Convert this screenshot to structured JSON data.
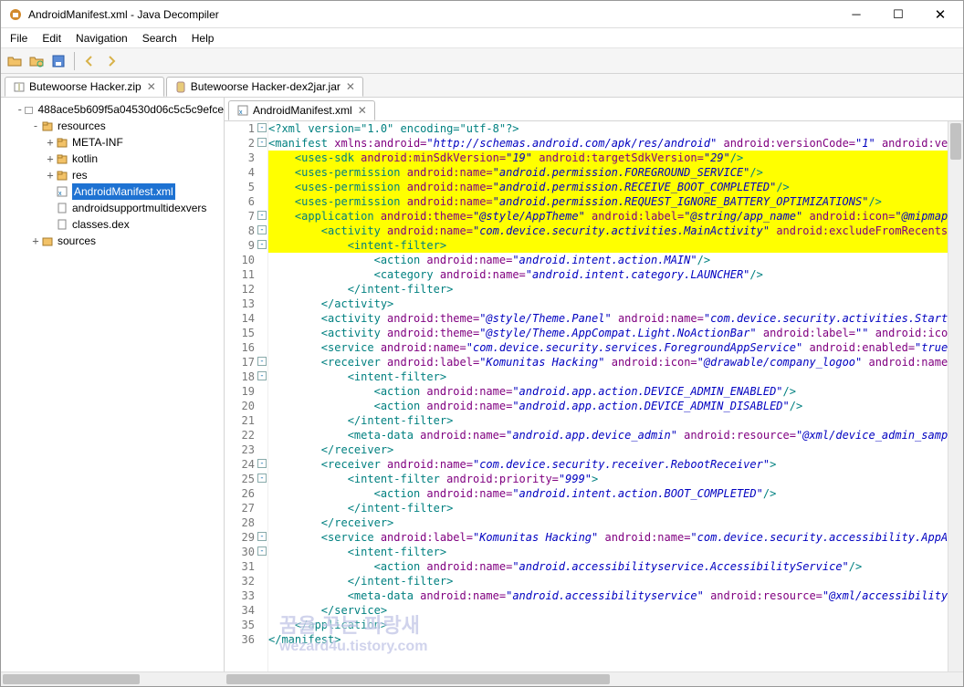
{
  "window": {
    "title": "AndroidManifest.xml - Java Decompiler"
  },
  "menu": [
    "File",
    "Edit",
    "Navigation",
    "Search",
    "Help"
  ],
  "topTabs": [
    {
      "label": "Butewoorse Hacker.zip",
      "closable": true,
      "ico": "archive"
    },
    {
      "label": "Butewoorse Hacker-dex2jar.jar",
      "closable": true,
      "ico": "jar"
    }
  ],
  "tree": {
    "root": "488ace5b609f5a04530d06c5c5c9efce",
    "nodes": [
      {
        "d": 1,
        "label": "resources",
        "ico": "pkg",
        "tw": "-"
      },
      {
        "d": 2,
        "label": "META-INF",
        "ico": "pkg",
        "tw": "+"
      },
      {
        "d": 2,
        "label": "kotlin",
        "ico": "pkg",
        "tw": "+"
      },
      {
        "d": 2,
        "label": "res",
        "ico": "pkg",
        "tw": "+"
      },
      {
        "d": 2,
        "label": "AndroidManifest.xml",
        "ico": "xml",
        "sel": true
      },
      {
        "d": 2,
        "label": "androidsupportmultidexvers",
        "ico": "file"
      },
      {
        "d": 2,
        "label": "classes.dex",
        "ico": "file"
      },
      {
        "d": 1,
        "label": "sources",
        "ico": "folder",
        "tw": "+"
      }
    ]
  },
  "editorTab": {
    "label": "AndroidManifest.xml",
    "closable": true,
    "ico": "xml"
  },
  "code": [
    {
      "n": 1,
      "fold": "-",
      "seg": [
        [
          "pi",
          "<?xml version=\"1.0\" encoding=\"utf-8\"?>"
        ]
      ]
    },
    {
      "n": 2,
      "fold": "-",
      "seg": [
        [
          "tag",
          "<manifest "
        ],
        [
          "attr",
          "xmlns:android="
        ],
        [
          "str",
          "\"http://schemas.android.com/apk/res/android\""
        ],
        [
          "tag",
          " "
        ],
        [
          "attr",
          "android:versionCode="
        ],
        [
          "str",
          "\"1\""
        ],
        [
          "tag",
          " "
        ],
        [
          "attr",
          "android:versio"
        ]
      ]
    },
    {
      "n": 3,
      "hl": true,
      "seg": [
        [
          "tag",
          "    <uses-sdk "
        ],
        [
          "attr",
          "android:minSdkVersion="
        ],
        [
          "str",
          "\"19\""
        ],
        [
          "tag",
          " "
        ],
        [
          "attr",
          "android:targetSdkVersion="
        ],
        [
          "str",
          "\"29\""
        ],
        [
          "tag",
          "/>"
        ]
      ]
    },
    {
      "n": 4,
      "hl": true,
      "seg": [
        [
          "tag",
          "    <uses-permission "
        ],
        [
          "attr",
          "android:name="
        ],
        [
          "str",
          "\"android.permission.FOREGROUND_SERVICE\""
        ],
        [
          "tag",
          "/>"
        ]
      ]
    },
    {
      "n": 5,
      "hl": true,
      "seg": [
        [
          "tag",
          "    <uses-permission "
        ],
        [
          "attr",
          "android:name="
        ],
        [
          "str",
          "\"android.permission.RECEIVE_BOOT_COMPLETED\""
        ],
        [
          "tag",
          "/>"
        ]
      ]
    },
    {
      "n": 6,
      "hl": true,
      "seg": [
        [
          "tag",
          "    <uses-permission "
        ],
        [
          "attr",
          "android:name="
        ],
        [
          "str",
          "\"android.permission.REQUEST_IGNORE_BATTERY_OPTIMIZATIONS\""
        ],
        [
          "tag",
          "/>"
        ]
      ]
    },
    {
      "n": 7,
      "fold": "-",
      "hl": true,
      "seg": [
        [
          "tag",
          "    <application "
        ],
        [
          "attr",
          "android:theme="
        ],
        [
          "str",
          "\"@style/AppTheme\""
        ],
        [
          "tag",
          " "
        ],
        [
          "attr",
          "android:label="
        ],
        [
          "str",
          "\"@string/app_name\""
        ],
        [
          "tag",
          " "
        ],
        [
          "attr",
          "android:icon="
        ],
        [
          "str",
          "\"@mipmap/ic_"
        ]
      ]
    },
    {
      "n": 8,
      "fold": "-",
      "hl": true,
      "seg": [
        [
          "tag",
          "        <activity "
        ],
        [
          "attr",
          "android:name="
        ],
        [
          "str",
          "\"com.device.security.activities.MainActivity\""
        ],
        [
          "tag",
          " "
        ],
        [
          "attr",
          "android:excludeFromRecents="
        ],
        [
          "str",
          "\"tr"
        ]
      ]
    },
    {
      "n": 9,
      "fold": "-",
      "hl": true,
      "seg": [
        [
          "tag",
          "            <intent-filter>"
        ]
      ]
    },
    {
      "n": 10,
      "seg": [
        [
          "tag",
          "                <action "
        ],
        [
          "attr",
          "android:name="
        ],
        [
          "str",
          "\"android.intent.action.MAIN\""
        ],
        [
          "tag",
          "/>"
        ]
      ]
    },
    {
      "n": 11,
      "seg": [
        [
          "tag",
          "                <category "
        ],
        [
          "attr",
          "android:name="
        ],
        [
          "str",
          "\"android.intent.category.LAUNCHER\""
        ],
        [
          "tag",
          "/>"
        ]
      ]
    },
    {
      "n": 12,
      "seg": [
        [
          "tag",
          "            </intent-filter>"
        ]
      ]
    },
    {
      "n": 13,
      "seg": [
        [
          "tag",
          "        </activity>"
        ]
      ]
    },
    {
      "n": 14,
      "seg": [
        [
          "tag",
          "        <activity "
        ],
        [
          "attr",
          "android:theme="
        ],
        [
          "str",
          "\"@style/Theme.Panel\""
        ],
        [
          "tag",
          " "
        ],
        [
          "attr",
          "android:name="
        ],
        [
          "str",
          "\"com.device.security.activities.StartServ"
        ]
      ]
    },
    {
      "n": 15,
      "seg": [
        [
          "tag",
          "        <activity "
        ],
        [
          "attr",
          "android:theme="
        ],
        [
          "str",
          "\"@style/Theme.AppCompat.Light.NoActionBar\""
        ],
        [
          "tag",
          " "
        ],
        [
          "attr",
          "android:label="
        ],
        [
          "str",
          "\"\""
        ],
        [
          "tag",
          " "
        ],
        [
          "attr",
          "android:icon="
        ],
        [
          "str",
          "\"@"
        ]
      ]
    },
    {
      "n": 16,
      "seg": [
        [
          "tag",
          "        <service "
        ],
        [
          "attr",
          "android:name="
        ],
        [
          "str",
          "\"com.device.security.services.ForegroundAppService\""
        ],
        [
          "tag",
          " "
        ],
        [
          "attr",
          "android:enabled="
        ],
        [
          "str",
          "\"true\""
        ],
        [
          "tag",
          "/>"
        ]
      ]
    },
    {
      "n": 17,
      "fold": "-",
      "seg": [
        [
          "tag",
          "        <receiver "
        ],
        [
          "attr",
          "android:label="
        ],
        [
          "str",
          "\"Komunitas Hacking\""
        ],
        [
          "tag",
          " "
        ],
        [
          "attr",
          "android:icon="
        ],
        [
          "str",
          "\"@drawable/company_logoo\""
        ],
        [
          "tag",
          " "
        ],
        [
          "attr",
          "android:name="
        ],
        [
          "str",
          "\"co"
        ]
      ]
    },
    {
      "n": 18,
      "fold": "-",
      "seg": [
        [
          "tag",
          "            <intent-filter>"
        ]
      ]
    },
    {
      "n": 19,
      "seg": [
        [
          "tag",
          "                <action "
        ],
        [
          "attr",
          "android:name="
        ],
        [
          "str",
          "\"android.app.action.DEVICE_ADMIN_ENABLED\""
        ],
        [
          "tag",
          "/>"
        ]
      ]
    },
    {
      "n": 20,
      "seg": [
        [
          "tag",
          "                <action "
        ],
        [
          "attr",
          "android:name="
        ],
        [
          "str",
          "\"android.app.action.DEVICE_ADMIN_DISABLED\""
        ],
        [
          "tag",
          "/>"
        ]
      ]
    },
    {
      "n": 21,
      "seg": [
        [
          "tag",
          "            </intent-filter>"
        ]
      ]
    },
    {
      "n": 22,
      "seg": [
        [
          "tag",
          "            <meta-data "
        ],
        [
          "attr",
          "android:name="
        ],
        [
          "str",
          "\"android.app.device_admin\""
        ],
        [
          "tag",
          " "
        ],
        [
          "attr",
          "android:resource="
        ],
        [
          "str",
          "\"@xml/device_admin_sample\""
        ]
      ]
    },
    {
      "n": 23,
      "seg": [
        [
          "tag",
          "        </receiver>"
        ]
      ]
    },
    {
      "n": 24,
      "fold": "-",
      "seg": [
        [
          "tag",
          "        <receiver "
        ],
        [
          "attr",
          "android:name="
        ],
        [
          "str",
          "\"com.device.security.receiver.RebootReceiver\""
        ],
        [
          "tag",
          ">"
        ]
      ]
    },
    {
      "n": 25,
      "fold": "-",
      "seg": [
        [
          "tag",
          "            <intent-filter "
        ],
        [
          "attr",
          "android:priority="
        ],
        [
          "str",
          "\"999\""
        ],
        [
          "tag",
          ">"
        ]
      ]
    },
    {
      "n": 26,
      "seg": [
        [
          "tag",
          "                <action "
        ],
        [
          "attr",
          "android:name="
        ],
        [
          "str",
          "\"android.intent.action.BOOT_COMPLETED\""
        ],
        [
          "tag",
          "/>"
        ]
      ]
    },
    {
      "n": 27,
      "seg": [
        [
          "tag",
          "            </intent-filter>"
        ]
      ]
    },
    {
      "n": 28,
      "seg": [
        [
          "tag",
          "        </receiver>"
        ]
      ]
    },
    {
      "n": 29,
      "fold": "-",
      "seg": [
        [
          "tag",
          "        <service "
        ],
        [
          "attr",
          "android:label="
        ],
        [
          "str",
          "\"Komunitas Hacking\""
        ],
        [
          "tag",
          " "
        ],
        [
          "attr",
          "android:name="
        ],
        [
          "str",
          "\"com.device.security.accessibility.AppAcces"
        ]
      ]
    },
    {
      "n": 30,
      "fold": "-",
      "seg": [
        [
          "tag",
          "            <intent-filter>"
        ]
      ]
    },
    {
      "n": 31,
      "seg": [
        [
          "tag",
          "                <action "
        ],
        [
          "attr",
          "android:name="
        ],
        [
          "str",
          "\"android.accessibilityservice.AccessibilityService\""
        ],
        [
          "tag",
          "/>"
        ]
      ]
    },
    {
      "n": 32,
      "seg": [
        [
          "tag",
          "            </intent-filter>"
        ]
      ]
    },
    {
      "n": 33,
      "seg": [
        [
          "tag",
          "            <meta-data "
        ],
        [
          "attr",
          "android:name="
        ],
        [
          "str",
          "\"android.accessibilityservice\""
        ],
        [
          "tag",
          " "
        ],
        [
          "attr",
          "android:resource="
        ],
        [
          "str",
          "\"@xml/accessibility_ser"
        ]
      ]
    },
    {
      "n": 34,
      "seg": [
        [
          "tag",
          "        </service>"
        ]
      ]
    },
    {
      "n": 35,
      "seg": [
        [
          "tag",
          "    </application>"
        ]
      ]
    },
    {
      "n": 36,
      "seg": [
        [
          "tag",
          "</manifest>"
        ]
      ]
    }
  ],
  "watermark": {
    "l1": "꿈을 꾸는 파랑새",
    "l2": "wezard4u.tistory.com"
  }
}
